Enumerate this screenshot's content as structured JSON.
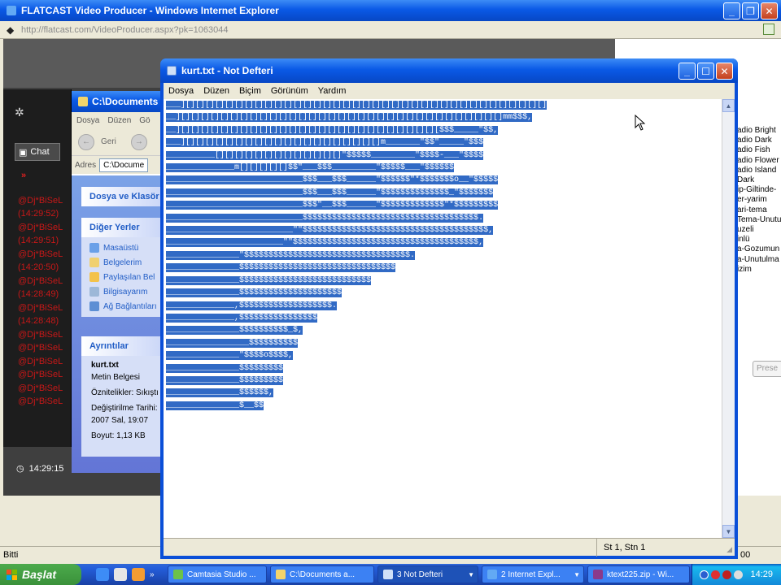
{
  "ie": {
    "title": "FLATCAST Video Producer - Windows Internet Explorer",
    "address": "http://flatcast.com/VideoProducer.aspx?pk=1063044",
    "status": "Bitti",
    "zoom_fragment": "00"
  },
  "flatcast": {
    "chat_label": "Chat",
    "chat_lines": [
      "@Dj*BiSeL",
      "(14:29:52)",
      "@Dj*BiSeL",
      "(14:29:51)",
      "@Dj*BiSeL",
      "(14:20:50)",
      "@Dj*BiSeL",
      "(14:28:49)",
      "@Dj*BiSeL",
      "(14:28:48)",
      "@Dj*BiSeL",
      "@Dj*BiSeL",
      "@Dj*BiSeL",
      "@Dj*BiSeL",
      "@Dj*BiSeL",
      "@Dj*BiSeL"
    ],
    "time": "14:29:15",
    "styles": [
      "adio Bright",
      "adio Dark",
      "adio Fish",
      "adio Flower",
      "adio Island",
      "Dark",
      "ip-Giltinde-",
      "er-yarim",
      "ari-tema",
      "Tema-Unutu",
      "uzeli",
      "inlü",
      "a-Gozumun",
      "a-Unutulma",
      "izim"
    ],
    "preset_label": "Prese"
  },
  "explorer": {
    "title": "C:\\Documents a",
    "menu": [
      "Dosya",
      "Düzen",
      "Gö"
    ],
    "back_label": "Geri",
    "address_label": "Adres",
    "address_value": "C:\\Docume",
    "tasks_header": "Dosya ve Klasör",
    "other_header": "Diğer Yerler",
    "other_items": [
      "Masaüstü",
      "Belgelerim",
      "Paylaşılan Bel",
      "Bilgisayarım",
      "Ağ Bağlantıları"
    ],
    "details_header": "Ayrıntılar",
    "details": {
      "name": "kurt.txt",
      "type": "Metin Belgesi",
      "attributes": "Öznitelikler: Sıkıştı",
      "modified_label": "Değiştirilme Tarihi:",
      "modified_value": "2007 Sal, 19:07",
      "size": "Boyut: 1,13 KB"
    }
  },
  "notepad": {
    "title": "kurt.txt - Not Defteri",
    "menu": [
      "Dosya",
      "Düzen",
      "Biçim",
      "Görünüm",
      "Yardım"
    ],
    "status": "St 1, Stn 1",
    "lines": [
      "___][][][][][][][][][][][][][][][][][][][][][][][][][][][][][][][][][][][][][]",
      "__][][][][][][][][][][][][][][][][][][][][][][][][][][][][][][][][][]mm$$$,",
      "__][][][][][][][][][][][][][][][][][][][][][][][][][][][$$$_____\"$$,",
      "___][][][][][][][][][][][][][][][][][][][][]m_______\"$$\"_____\"$$$",
      "__________[][][][][][][][][][][][][]\"$$$$$_________\"$$$$-___\"$$$$",
      "______________m[][][][][]$$\"___$$$_________\"$$$$$___\"$$$$$$",
      "____________________________$$$___$$$______\"$$$$$$\"*$$$$$$$o__\"$$$$$",
      "____________________________$$$___$$$______\"$$$$$$$$$$$$$$_\"$$$$$$$",
      "____________________________$$$\"__$$$______\"$$$$$$$$$$$$$\"*$$$$$$$$$",
      "____________________________$$$$$$$$$$$$$$$$$$$$$$$$$$$$$$$$$$$$.",
      "__________________________\"\"$$$$$$$$$$$$$$$$$$$$$$$$$$$$$$$$$$$$$$,",
      "________________________\"\"$$$$$$$$$$$$$$$$$$$$$$$$$$$$$$$$$$$$$$,",
      "_______________\"$$$$$$$$$$$$$$$$$$$$$$$$$$$$$$$$$$.",
      "_______________$$$$$$$$$$$$$$$$$$$$$$$$$$$$$$$$",
      "_______________$$$$$$$$$$$$$$$$$$$$$$$$$$$",
      "_______________$$$$$$$$$$$$$$$$$$$$$",
      "______________,$$$$$$$$$$$$$$$$$$$.",
      "______________,$$$$$$$$$$$$$$$$",
      "_______________$$$$$$$$$$_$,",
      "_________________$$$$$$$$$$",
      "_______________\"$$$$o$$$$,",
      "_______________$$$$$$$$$",
      "_______________$$$$$$$$$",
      "_______________$$$$$$,",
      "_______________$__$$"
    ]
  },
  "taskbar": {
    "start_label": "Başlat",
    "items": [
      "Camtasia Studio ...",
      "C:\\Documents a...",
      "3 Not Defteri",
      "2 Internet Expl...",
      "ktext225.zip - Wi..."
    ],
    "clock": "14:29"
  }
}
